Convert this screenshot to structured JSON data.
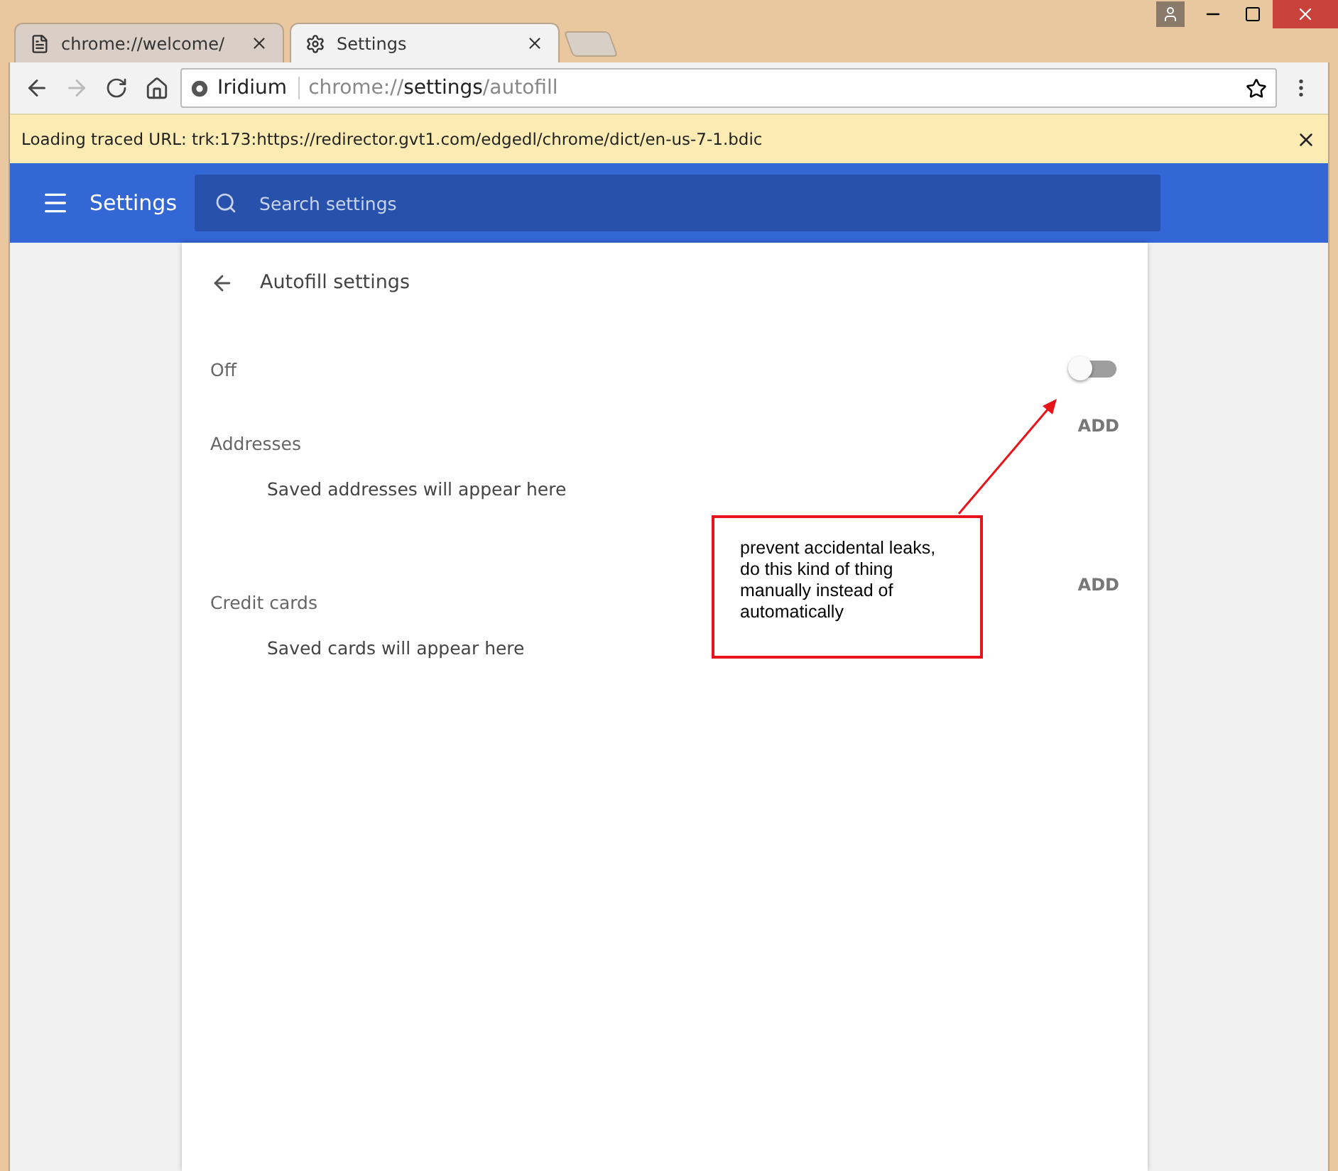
{
  "tabs": [
    {
      "title": "chrome://welcome/",
      "kind": "page",
      "selected": false
    },
    {
      "title": "Settings",
      "kind": "gear",
      "selected": true
    }
  ],
  "address_bar": {
    "site_name": "Iridium",
    "url_scheme": "chrome://",
    "url_host": "settings",
    "url_path": "/autofill"
  },
  "infobar": {
    "message": "Loading traced URL: trk:173:https://redirector.gvt1.com/edgedl/chrome/dict/en-us-7-1.bdic"
  },
  "header": {
    "title": "Settings",
    "search_placeholder": "Search settings"
  },
  "page": {
    "title": "Autofill settings",
    "autofill": {
      "label": "Off",
      "on": false
    },
    "sections": [
      {
        "title": "Addresses",
        "action": "ADD",
        "empty_text": "Saved addresses will appear here"
      },
      {
        "title": "Credit cards",
        "action": "ADD",
        "empty_text": "Saved cards will appear here"
      }
    ]
  },
  "annotation": {
    "text": "prevent accidental leaks, do this kind of thing manually instead of automatically"
  }
}
